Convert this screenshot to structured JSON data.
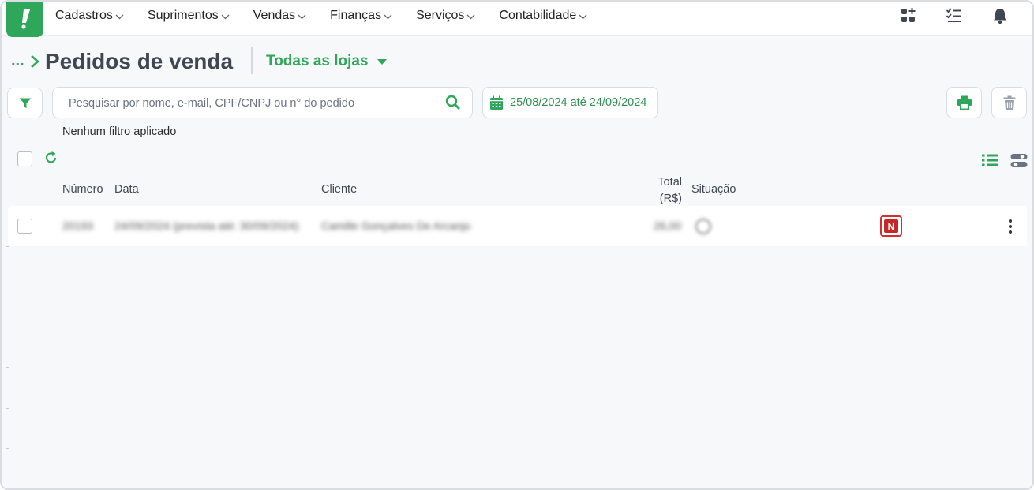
{
  "nav": {
    "logo_glyph": "!",
    "items": [
      "Cadastros",
      "Suprimentos",
      "Vendas",
      "Finanças",
      "Serviços",
      "Contabilidade"
    ],
    "icons": [
      "apps-add-icon",
      "checklist-icon",
      "bell-icon"
    ]
  },
  "header": {
    "breadcrumb": "...",
    "title": "Pedidos de venda",
    "store_selector": "Todas as lojas"
  },
  "toolbar": {
    "search_placeholder": "Pesquisar por nome, e-mail, CPF/CNPJ ou n° do pedido",
    "date_range": "25/08/2024 até 24/09/2024",
    "filter_status": "Nenhum filtro aplicado"
  },
  "table": {
    "columns": {
      "numero": "Número",
      "data": "Data",
      "cliente": "Cliente",
      "total": "Total (R$)",
      "situacao": "Situação"
    },
    "rows": [
      {
        "numero": "20193",
        "data": "24/09/2024 (prevista até: 30/09/2024)",
        "cliente": "Camille Gonçalves De Arcanjo",
        "total": "26,00",
        "badge": "N"
      }
    ]
  },
  "colors": {
    "brand_green": "#2fa75a",
    "badge_red": "#c62828"
  }
}
